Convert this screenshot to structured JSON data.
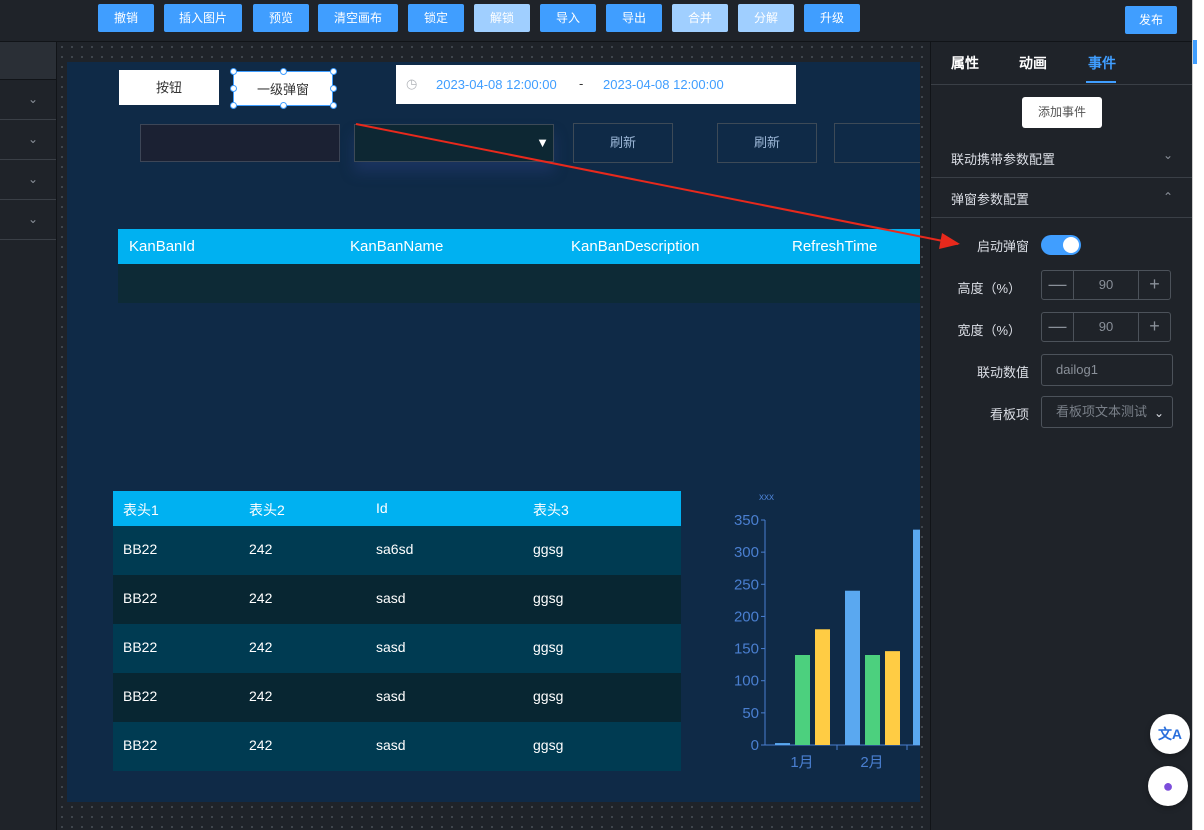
{
  "toolbar": {
    "buttons": [
      "撤销",
      "插入图片",
      "预览",
      "清空画布",
      "锁定",
      "解锁",
      "导入",
      "导出",
      "合并",
      "分解",
      "升级"
    ],
    "publish": "发布"
  },
  "canvas": {
    "button_label": "按钮",
    "dialog_label": "一级弹窗",
    "date_start": "2023-04-08 12:00:00",
    "date_sep": "-",
    "date_end": "2023-04-08 12:00:00",
    "refresh1": "刷新",
    "refresh2": "刷新",
    "kanban_headers": [
      "KanBanId",
      "KanBanName",
      "KanBanDescription",
      "RefreshTime"
    ],
    "table_headers": [
      "表头1",
      "表头2",
      "Id",
      "表头3"
    ],
    "table_rows": [
      [
        "BB22",
        "242",
        "sa6sd",
        "ggsg"
      ],
      [
        "BB22",
        "242",
        "sasd",
        "ggsg"
      ],
      [
        "BB22",
        "242",
        "sasd",
        "ggsg"
      ],
      [
        "BB22",
        "242",
        "sasd",
        "ggsg"
      ],
      [
        "BB22",
        "242",
        "sasd",
        "ggsg"
      ]
    ]
  },
  "chart_data": {
    "type": "bar",
    "ylabel": "xxx",
    "ylim": [
      0,
      350
    ],
    "yticks": [
      0,
      50,
      100,
      150,
      200,
      250,
      300,
      350
    ],
    "categories": [
      "1月",
      "2月"
    ],
    "series": [
      {
        "color": "#5aa8f0",
        "values": [
          3,
          240
        ]
      },
      {
        "color": "#4cd07e",
        "values": [
          140,
          140
        ]
      },
      {
        "color": "#ffcc44",
        "values": [
          180,
          146
        ]
      }
    ],
    "extra_bar": {
      "value": 335,
      "color": "#5aa8f0"
    }
  },
  "right_panel": {
    "tabs": [
      "属性",
      "动画",
      "事件"
    ],
    "active_tab": "事件",
    "add_event": "添加事件",
    "section1": "联动携带参数配置",
    "section2": "弹窗参数配置",
    "enable_dialog_label": "启动弹窗",
    "enable_dialog": true,
    "height_label": "高度（%）",
    "height_value": "90",
    "width_label": "宽度（%）",
    "width_value": "90",
    "link_value_label": "联动数值",
    "link_value_placeholder": "dailog1",
    "board_label": "看板项",
    "board_placeholder": "看板项文本测试"
  },
  "colors": {
    "accent": "#409eff",
    "table_header": "#00b1f1",
    "canvas_bg": "#0f2a47",
    "arrow": "#e8291c"
  }
}
